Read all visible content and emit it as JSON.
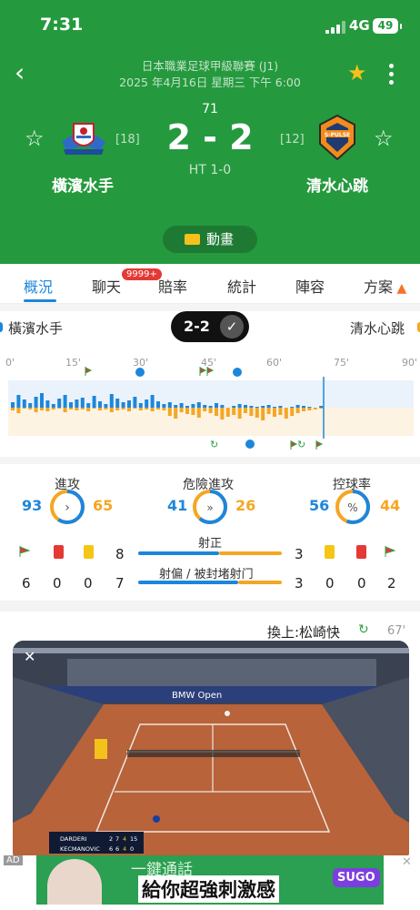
{
  "status_bar": {
    "time": "7:31",
    "network": "4G",
    "battery": "49"
  },
  "match": {
    "league": "日本職業足球甲級聯賽 (J1)",
    "datetime": "2025 年4月16日 星期三 下午 6:00",
    "minute": "71",
    "score": "2 - 2",
    "halftime": "HT 1-0",
    "home": {
      "name": "橫濱水手",
      "rank": "[18]"
    },
    "away": {
      "name": "清水心跳",
      "rank": "[12]"
    },
    "animation_label": "動畫"
  },
  "tabs": [
    {
      "label": "概況",
      "active": true
    },
    {
      "label": "聊天",
      "badge": "9999+"
    },
    {
      "label": "賠率"
    },
    {
      "label": "統計"
    },
    {
      "label": "陣容"
    },
    {
      "label": "方案"
    }
  ],
  "scoreline": {
    "home": "橫濱水手",
    "away": "清水心跳",
    "score": "2-2"
  },
  "timeline": {
    "ticks": [
      "0'",
      "15'",
      "30'",
      "45'",
      "60'",
      "75'",
      "90'"
    ],
    "current_minute": 71
  },
  "stats": {
    "attack": {
      "label": "進攻",
      "home": "93",
      "away": "65"
    },
    "dangerous": {
      "label": "危險進攻",
      "home": "41",
      "away": "26"
    },
    "possession": {
      "label": "控球率",
      "home": "56",
      "away": "44"
    },
    "shots_on": {
      "label": "射正",
      "home": "8",
      "away": "3"
    },
    "shots_off": {
      "label": "射偏 / 被封堵射门",
      "home": "7",
      "away": "3"
    },
    "home_corners": "6",
    "home_red": "0",
    "home_yellow": "0",
    "away_yellow": "0",
    "away_red": "0",
    "away_corners": "2"
  },
  "substitution": {
    "text": "換上:松崎快",
    "minute": "67'"
  },
  "video": {
    "event": "BMW Open",
    "player1": "DARDERI",
    "p1_scores": [
      "2",
      "7",
      "4",
      "15"
    ],
    "player2": "KECMANOVIC",
    "p2_scores": [
      "6",
      "6",
      "4",
      "0"
    ]
  },
  "ad": {
    "label": "AD",
    "line1": "一鍵通話",
    "line2": "給你超強刺激感",
    "brand": "SUGO"
  },
  "colors": {
    "header": "#25993e",
    "home": "#1d86dc",
    "away": "#f5a623"
  }
}
